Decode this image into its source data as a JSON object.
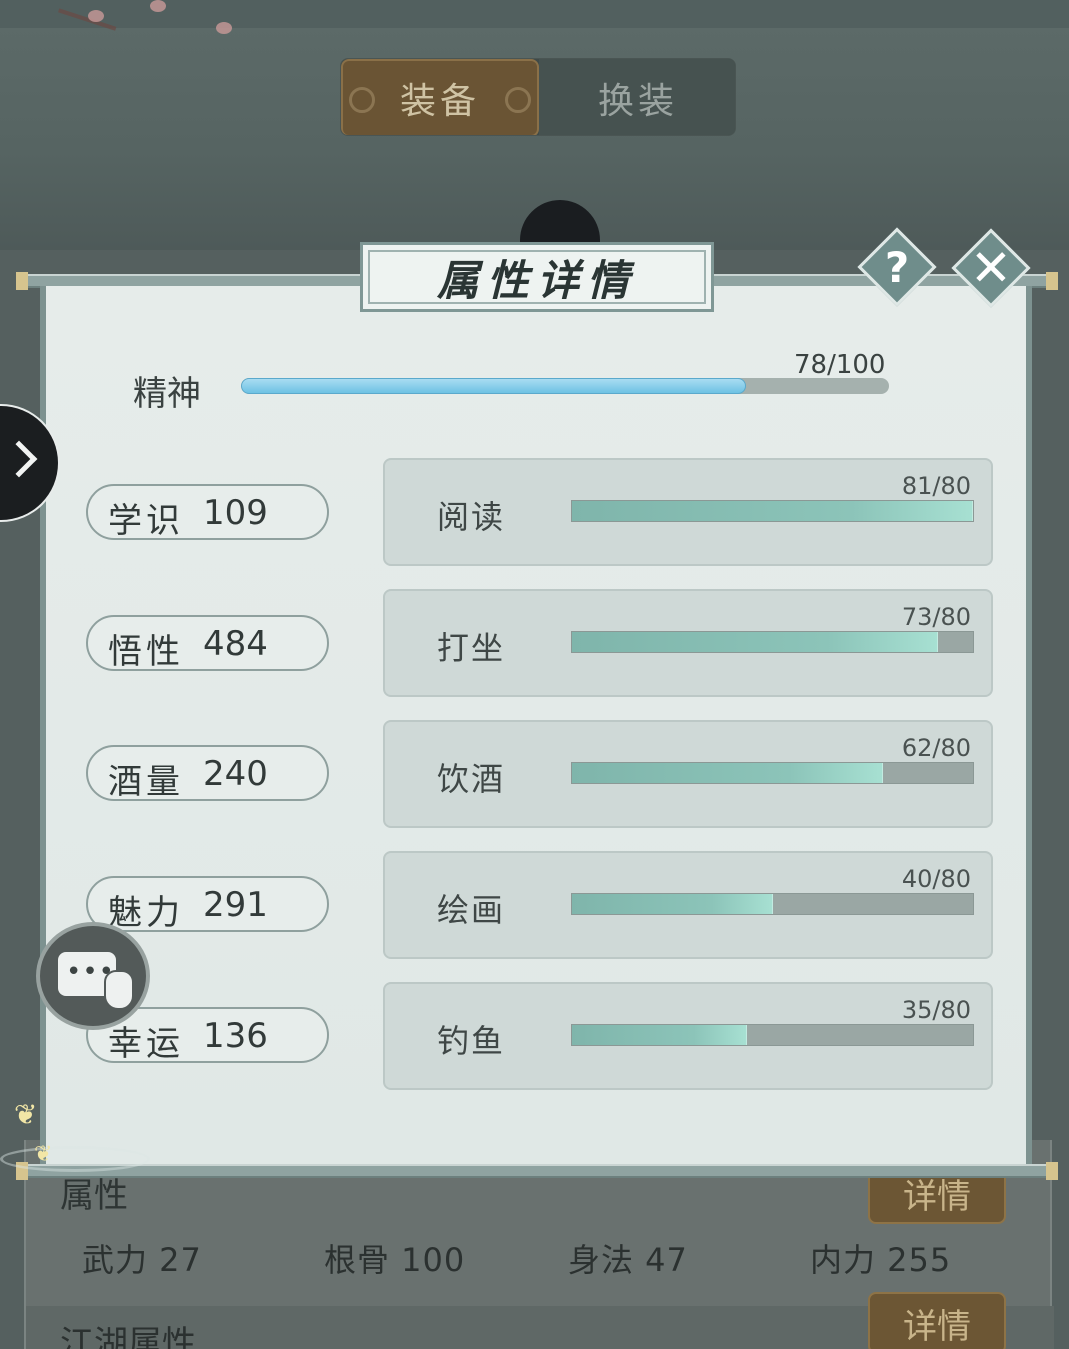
{
  "tabs": [
    {
      "label": "装备",
      "active": true
    },
    {
      "label": "换装",
      "active": false
    }
  ],
  "modal": {
    "title": "属性详情",
    "help_glyph": "?",
    "close_glyph": "✕"
  },
  "spirit": {
    "label": "精神",
    "value_text": "78/100",
    "current": 78,
    "max": 100
  },
  "attributes": [
    {
      "name": "学识",
      "value": "109"
    },
    {
      "name": "悟性",
      "value": "484"
    },
    {
      "name": "酒量",
      "value": "240"
    },
    {
      "name": "魅力",
      "value": "291"
    },
    {
      "name": "幸运",
      "value": "136"
    }
  ],
  "skills": [
    {
      "name": "阅读",
      "value_text": "81/80",
      "current": 81,
      "max": 80
    },
    {
      "name": "打坐",
      "value_text": "73/80",
      "current": 73,
      "max": 80
    },
    {
      "name": "饮酒",
      "value_text": "62/80",
      "current": 62,
      "max": 80
    },
    {
      "name": "绘画",
      "value_text": "40/80",
      "current": 40,
      "max": 80
    },
    {
      "name": "钓鱼",
      "value_text": "35/80",
      "current": 35,
      "max": 80
    }
  ],
  "background": {
    "section1_label": "属性",
    "detail_label": "详情",
    "stats": [
      {
        "text": "武力  27"
      },
      {
        "text": "根骨  100"
      },
      {
        "text": "身法  47"
      },
      {
        "text": "内力  255"
      }
    ],
    "section2_label": "江湖属性",
    "detail2_label": "详情"
  },
  "chat": {
    "dots": "•••"
  },
  "colors": {
    "spirit_fill": "#6ec2e4",
    "skill_fill": "#8cc4b9",
    "active_tab": "#6a5434"
  }
}
